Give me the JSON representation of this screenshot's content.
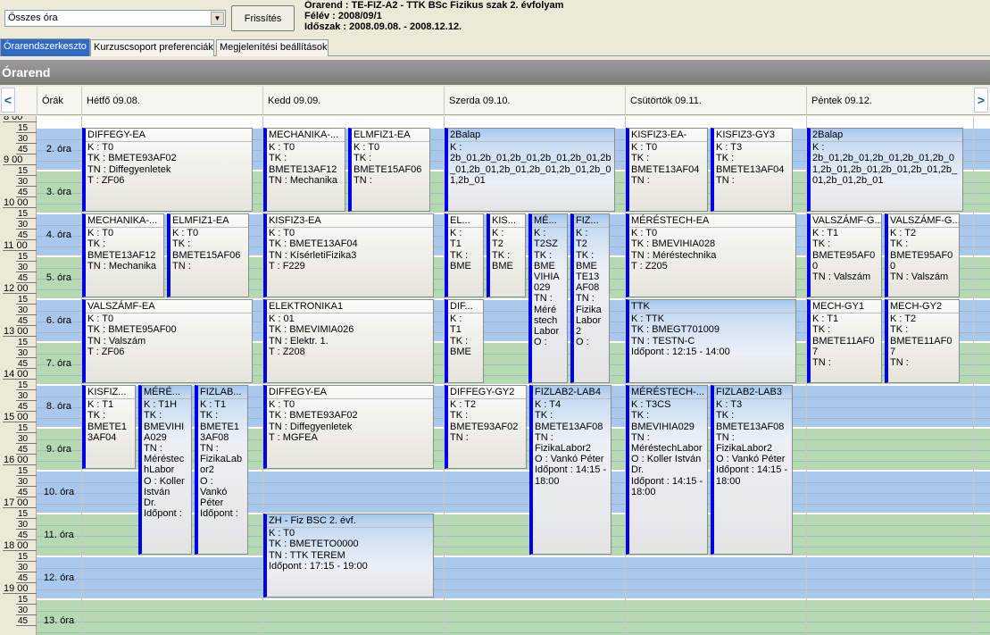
{
  "toolbar": {
    "combo_value": "Összes óra",
    "refresh_label": "Frissítés",
    "info_lines": [
      "Órarend : TE-FIZ-A2 - TTK BSc Fizikus szak 2. évfolyam",
      "Félév : 2008/09/1",
      "Időszak : 2008.09.08. - 2008.12.12."
    ]
  },
  "tabs": [
    {
      "label": "Órarendszerkeszto",
      "active": true
    },
    {
      "label": "Kurzuscsoport preferenciák",
      "active": false
    },
    {
      "label": "Megjelenítési beállítások",
      "active": false
    }
  ],
  "section_title": "Órarend",
  "header": {
    "prev_icon": "chevron-left-icon",
    "next_icon": "chevron-right-icon",
    "prev_glyph": "<",
    "next_glyph": ">",
    "hours_label": "Órák",
    "days": [
      "Hétfő 09.08.",
      "Kedd 09.09.",
      "Szerda 09.10.",
      "Csütörtök 09.11.",
      "Péntek 09.12."
    ]
  },
  "time_labels": [
    [
      "8 00",
      "15",
      "30",
      "45"
    ],
    [
      "9 00",
      "15",
      "30",
      "45"
    ],
    [
      "10 00",
      "15",
      "30",
      "45"
    ],
    [
      "11 00",
      "15",
      "30",
      "45"
    ],
    [
      "12 00",
      "15",
      "30",
      "45"
    ],
    [
      "13 00",
      "15",
      "30",
      "45"
    ],
    [
      "14 00",
      "15",
      "30",
      "45"
    ],
    [
      "15 00",
      "15",
      "30",
      "45"
    ],
    [
      "16 00",
      "15",
      "30",
      "45"
    ],
    [
      "17 00",
      "15",
      "30",
      "45"
    ],
    [
      "18 00",
      "15",
      "30",
      "45"
    ],
    [
      "19 00",
      "15",
      "30",
      "45"
    ]
  ],
  "periods": [
    "2. óra",
    "3. óra",
    "4. óra",
    "5. óra",
    "6. óra",
    "7. óra",
    "8. óra",
    "9. óra",
    "10. óra",
    "11. óra",
    "12. óra",
    "13. óra"
  ],
  "colors": {
    "accent": "#0000e6",
    "band_blue": "#a9c8ec",
    "band_green": "#b6d8b2",
    "tab_active": "#316ac5"
  },
  "events": [
    {
      "day": 0,
      "sub": 0,
      "of": 1,
      "start": 0,
      "span": 2,
      "blue": false,
      "title": "DIFFEGY-EA",
      "lines": [
        "K : T0",
        "TK : BMETE93AF02",
        "TN : Diffegyenletek",
        "T : ZF06"
      ]
    },
    {
      "day": 1,
      "sub": 0,
      "of": 2,
      "start": 0,
      "span": 2,
      "blue": false,
      "title": "MECHANIKA-...",
      "lines": [
        "K : T0",
        "TK :",
        "BMETE13AF12",
        "TN : Mechanika"
      ]
    },
    {
      "day": 1,
      "sub": 1,
      "of": 2,
      "start": 0,
      "span": 2,
      "blue": false,
      "title": "ELMFIZ1-EA",
      "lines": [
        "K : T0",
        "TK :",
        "BMETE15AF06",
        "TN :"
      ]
    },
    {
      "day": 2,
      "sub": 0,
      "of": 1,
      "start": 0,
      "span": 2,
      "blue": true,
      "title": "2Balap",
      "lines": [
        "K :",
        "2b_01,2b_01,2b_01,2b_01,2b_01,2b_01,2b_01,2b_01,2b_01,2b_01,2b_01,2b_01"
      ]
    },
    {
      "day": 3,
      "sub": 0,
      "of": 2,
      "start": 0,
      "span": 2,
      "blue": false,
      "title": "KISFIZ3-EA-",
      "lines": [
        "K : T0",
        "TK :",
        "BMETE13AF04",
        "TN :"
      ]
    },
    {
      "day": 3,
      "sub": 1,
      "of": 2,
      "start": 0,
      "span": 2,
      "blue": false,
      "title": "KISFIZ3-GY3",
      "lines": [
        "K : T3",
        "TK :",
        "BMETE13AF04",
        "TN :"
      ]
    },
    {
      "day": 4,
      "sub": 0,
      "of": 1,
      "start": 0,
      "span": 2,
      "blue": true,
      "title": "2Balap",
      "lines": [
        "K :",
        "2b_01,2b_01,2b_01,2b_01,2b_01,2b_01,2b_01,2b_01,2b_01,2b_01,2b_01,2b_01"
      ]
    },
    {
      "day": 0,
      "sub": 0,
      "of": 2,
      "start": 2,
      "span": 2,
      "blue": false,
      "title": "MECHANIKA-...",
      "lines": [
        "K : T0",
        "TK :",
        "BMETE13AF12",
        "TN : Mechanika"
      ]
    },
    {
      "day": 0,
      "sub": 1,
      "of": 2,
      "start": 2,
      "span": 2,
      "blue": false,
      "title": "ELMFIZ1-EA",
      "lines": [
        "K : T0",
        "TK :",
        "BMETE15AF06",
        "TN :"
      ]
    },
    {
      "day": 1,
      "sub": 0,
      "of": 1,
      "start": 2,
      "span": 2,
      "blue": false,
      "title": "KISFIZ3-EA",
      "lines": [
        "K : T0",
        "TK : BMETE13AF04",
        "TN : KísérletiFizika3",
        "T : F229"
      ]
    },
    {
      "day": 2,
      "sub": 0,
      "of": 4,
      "start": 2,
      "span": 2,
      "blue": false,
      "title": "EL...",
      "lines": [
        "K :",
        "T1",
        "TK :",
        "BME"
      ]
    },
    {
      "day": 2,
      "sub": 1,
      "of": 4,
      "start": 2,
      "span": 2,
      "blue": false,
      "title": "KIS...",
      "lines": [
        "K :",
        "T2",
        "TK :",
        "BME"
      ]
    },
    {
      "day": 2,
      "sub": 2,
      "of": 4,
      "start": 2,
      "span": 4,
      "blue": true,
      "title": "MÉ...",
      "lines": [
        "K :",
        "T2SZ",
        "TK :",
        "BME",
        "VIHIA",
        "029",
        "TN :",
        "Méré",
        "stech",
        "Labor",
        "O :"
      ]
    },
    {
      "day": 2,
      "sub": 3,
      "of": 4,
      "start": 2,
      "span": 4,
      "blue": true,
      "title": "FIZ...",
      "lines": [
        "K :",
        "T2",
        "TK :",
        "BME",
        "TE13",
        "AF08",
        "TN :",
        "Fizika",
        "Labor",
        "2",
        "O :"
      ]
    },
    {
      "day": 3,
      "sub": 0,
      "of": 1,
      "start": 2,
      "span": 2,
      "blue": false,
      "title": "MÉRÉSTECH-EA",
      "lines": [
        "K : T0",
        "TK : BMEVIHIA028",
        "TN : Méréstechnika",
        "T : Z205"
      ]
    },
    {
      "day": 4,
      "sub": 0,
      "of": 2,
      "start": 2,
      "span": 2,
      "blue": false,
      "title": "VALSZÁMF-G...",
      "lines": [
        "K : T1",
        "TK :",
        "BMETE95AF00",
        "TN : Valszám"
      ]
    },
    {
      "day": 4,
      "sub": 1,
      "of": 2,
      "start": 2,
      "span": 2,
      "blue": false,
      "title": "VALSZÁMF-G...",
      "lines": [
        "K : T2",
        "TK :",
        "BMETE95AF00",
        "TN : Valszám"
      ]
    },
    {
      "day": 0,
      "sub": 0,
      "of": 1,
      "start": 4,
      "span": 2,
      "blue": false,
      "title": "VALSZÁMF-EA",
      "lines": [
        "K : T0",
        "TK : BMETE95AF00",
        "TN : Valszám",
        "T : ZF06"
      ]
    },
    {
      "day": 1,
      "sub": 0,
      "of": 1,
      "start": 4,
      "span": 2,
      "blue": false,
      "title": "ELEKTRONIKA1",
      "lines": [
        "K : 01",
        "TK : BMEVIMIA026",
        "TN : Elektr. 1.",
        "T : Z208"
      ]
    },
    {
      "day": 2,
      "sub": 0,
      "of": 4,
      "start": 4,
      "span": 2,
      "blue": false,
      "title": "DIF...",
      "lines": [
        "K :",
        "T1",
        "TK :",
        "BME"
      ]
    },
    {
      "day": 3,
      "sub": 0,
      "of": 1,
      "start": 4,
      "span": 2,
      "blue": true,
      "title": "TTK",
      "lines": [
        "K : TTK",
        "TK : BMEGT701009",
        "TN : TESTN-C",
        "Időpont : 12:15 - 14:00"
      ]
    },
    {
      "day": 4,
      "sub": 0,
      "of": 2,
      "start": 4,
      "span": 2,
      "blue": false,
      "title": "MECH-GY1",
      "lines": [
        "K : T1",
        "TK :",
        "BMETE11AF07",
        "TN :"
      ]
    },
    {
      "day": 4,
      "sub": 1,
      "of": 2,
      "start": 4,
      "span": 2,
      "blue": false,
      "title": "MECH-GY2",
      "lines": [
        "K : T2",
        "TK :",
        "BMETE11AF07",
        "TN :"
      ]
    },
    {
      "day": 0,
      "sub": 0,
      "of": 3,
      "start": 6,
      "span": 2,
      "blue": false,
      "title": "KISFIZ...",
      "lines": [
        "K : T1",
        "TK :",
        "BMETE1",
        "3AF04"
      ]
    },
    {
      "day": 0,
      "sub": 1,
      "of": 3,
      "start": 6,
      "span": 4,
      "blue": true,
      "title": "MÉRÉ...",
      "lines": [
        "K : T1H",
        "TK :",
        "BMEVIHI",
        "A029",
        "TN :",
        "Méréstec",
        "hLabor",
        "O : Koller",
        "István",
        "Dr.",
        "Időpont :"
      ]
    },
    {
      "day": 0,
      "sub": 2,
      "of": 3,
      "start": 6,
      "span": 4,
      "blue": true,
      "title": "FIZLAB...",
      "lines": [
        "K : T1",
        "TK :",
        "BMETE1",
        "3AF08",
        "TN :",
        "FizikaLab",
        "or2",
        "O :",
        "Vankó",
        "Péter",
        "Időpont :"
      ]
    },
    {
      "day": 1,
      "sub": 0,
      "of": 1,
      "start": 6,
      "span": 2,
      "blue": false,
      "title": "DIFFEGY-EA",
      "lines": [
        "K : T0",
        "TK : BMETE93AF02",
        "TN : Diffegyenletek",
        "T : MGFEA"
      ]
    },
    {
      "day": 2,
      "sub": 0,
      "of": 2,
      "start": 6,
      "span": 2,
      "blue": false,
      "title": "DIFFEGY-GY2",
      "lines": [
        "K : T2",
        "TK :",
        "BMETE93AF02",
        "TN :"
      ]
    },
    {
      "day": 2,
      "sub": 1,
      "of": 2,
      "start": 6,
      "span": 4,
      "blue": true,
      "title": "FIZLAB2-LAB4",
      "lines": [
        "K : T4",
        "TK :",
        "BMETE13AF08",
        "TN :",
        "FizikaLabor2",
        "O : Vankó Péter",
        "Időpont : 14:15 -",
        "18:00"
      ]
    },
    {
      "day": 3,
      "sub": 0,
      "of": 2,
      "start": 6,
      "span": 4,
      "blue": true,
      "title": "MÉRÉSTECH-...",
      "lines": [
        "K : T3CS",
        "TK :",
        "BMEVIHIA029",
        "TN :",
        "MéréstechLabor",
        "O : Koller István",
        "Dr.",
        "Időpont : 14:15 -",
        "18:00"
      ]
    },
    {
      "day": 3,
      "sub": 1,
      "of": 2,
      "start": 6,
      "span": 4,
      "blue": true,
      "title": "FIZLAB2-LAB3",
      "lines": [
        "K : T3",
        "TK :",
        "BMETE13AF08",
        "TN :",
        "FizikaLabor2",
        "O : Vankó Péter",
        "Időpont : 14:15 -",
        "18:00"
      ]
    },
    {
      "day": 1,
      "sub": 0,
      "of": 1,
      "start": 9,
      "span": 2,
      "blue": true,
      "title": "ZH - Fiz BSC 2. évf.",
      "lines": [
        "K : T0",
        "TK : BMETETO0000",
        "TN : TTK TEREM",
        "Időpont : 17:15 - 19:00"
      ]
    }
  ]
}
